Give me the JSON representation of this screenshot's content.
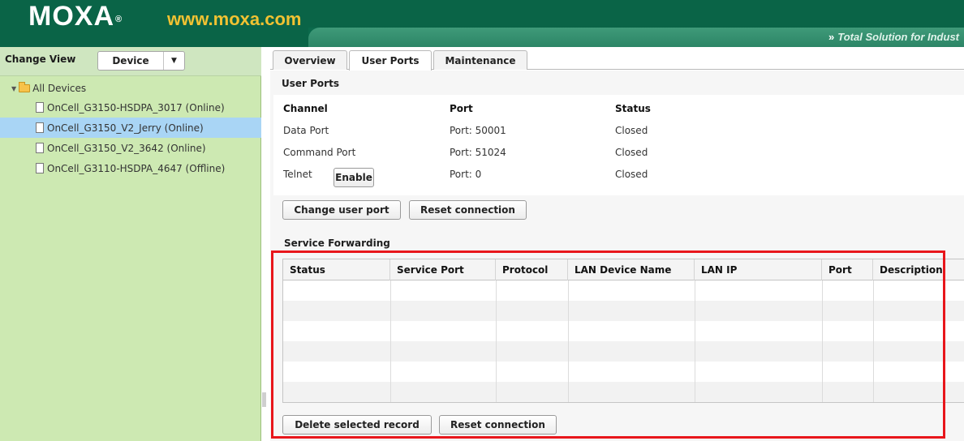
{
  "header": {
    "logo": "MOXA",
    "logo_mark": "®",
    "url": "www.moxa.com",
    "tagline_chevron": "»",
    "tagline": "Total Solution for Indust"
  },
  "sidebar": {
    "change_view_label": "Change View",
    "view_select": "Device",
    "root_label": "All Devices",
    "items": [
      {
        "label": "OnCell_G3150-HSDPA_3017 (Online)",
        "selected": false
      },
      {
        "label": "OnCell_G3150_V2_Jerry (Online)",
        "selected": true
      },
      {
        "label": "OnCell_G3150_V2_3642 (Online)",
        "selected": false
      },
      {
        "label": "OnCell_G3110-HSDPA_4647 (Offline)",
        "selected": false
      }
    ]
  },
  "tabs": [
    {
      "label": "Overview",
      "active": false
    },
    {
      "label": "User Ports",
      "active": true
    },
    {
      "label": "Maintenance",
      "active": false
    }
  ],
  "user_ports": {
    "title": "User Ports",
    "headers": {
      "channel": "Channel",
      "port": "Port",
      "status": "Status"
    },
    "rows": [
      {
        "channel": "Data Port",
        "port": "Port: 50001",
        "status": "Closed"
      },
      {
        "channel": "Command Port",
        "port": "Port: 51024",
        "status": "Closed"
      },
      {
        "channel": "Telnet",
        "port": "Port: 0",
        "status": "Closed",
        "button": "Enable"
      }
    ],
    "change_button": "Change user port",
    "reset_button": "Reset connection"
  },
  "service_forwarding": {
    "title": "Service Forwarding",
    "columns": [
      "Status",
      "Service Port",
      "Protocol",
      "LAN Device Name",
      "LAN IP",
      "Port",
      "Description"
    ],
    "delete_button": "Delete selected record",
    "reset_button": "Reset connection"
  },
  "colors": {
    "banner": "#0b6a4c",
    "sidebar_bg": "#cde9b2",
    "selected_row": "#a9d5f5",
    "highlight_box": "#e8161b",
    "url_text": "#f1c232"
  }
}
